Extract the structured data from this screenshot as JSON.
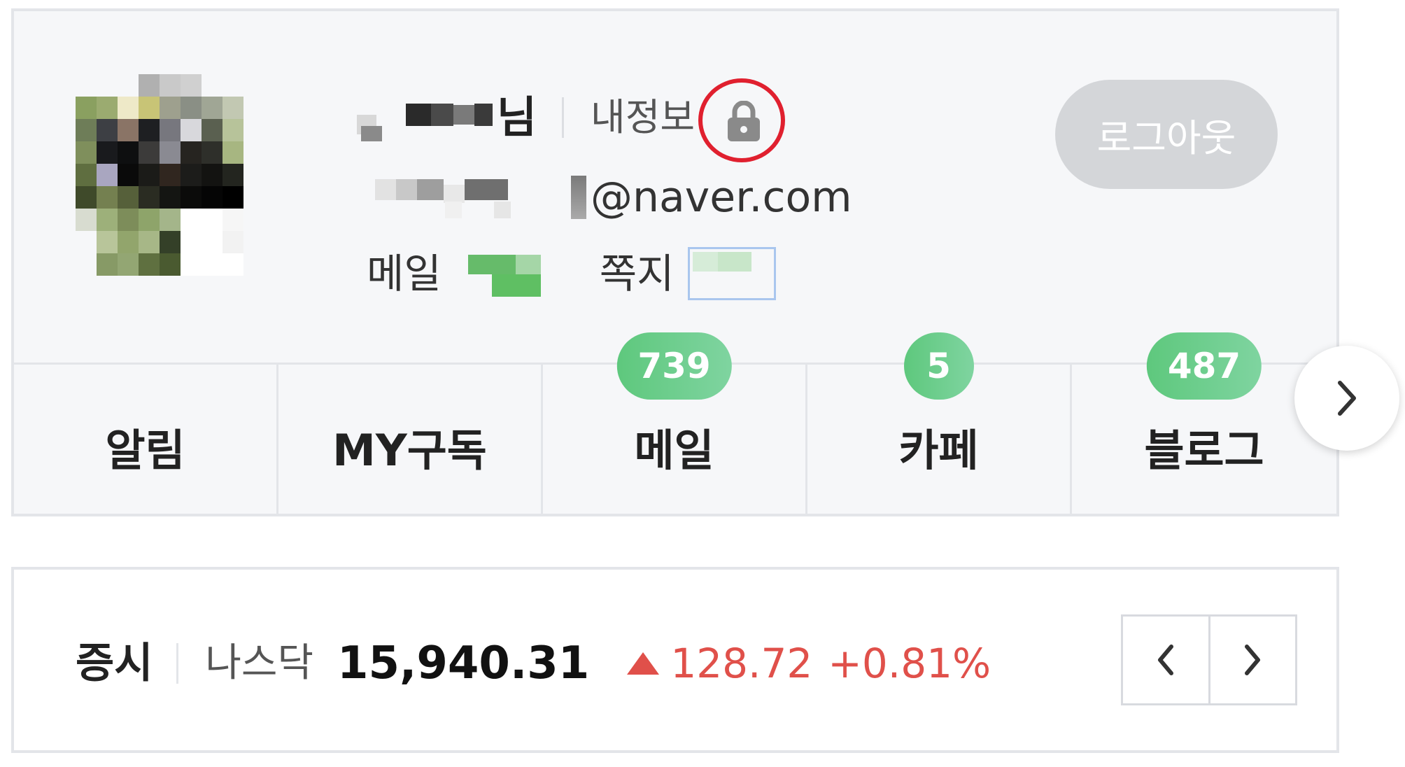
{
  "profile": {
    "username_suffix": "님",
    "myinfo_label": "내정보",
    "logout_label": "로그아웃",
    "email_domain": "@naver.com",
    "mail_label": "메일",
    "note_label": "쪽지"
  },
  "menu": {
    "items": [
      {
        "label": "알림",
        "badge": null
      },
      {
        "label": "MY구독",
        "badge": null
      },
      {
        "label": "메일",
        "badge": "739"
      },
      {
        "label": "카페",
        "badge": "5"
      },
      {
        "label": "블로그",
        "badge": "487"
      }
    ]
  },
  "stock": {
    "title": "증시",
    "index_name": "나스닥",
    "value": "15,940.31",
    "change": "128.72",
    "percent": "+0.81%",
    "direction": "up",
    "up_color": "#e0504a"
  },
  "icons": {
    "lock": "lock-icon",
    "menu_next": "chevron-right-icon",
    "stock_prev": "chevron-left-icon",
    "stock_next": "chevron-right-icon"
  },
  "colors": {
    "badge": "#6acb8a",
    "highlight_ring": "#e0202f",
    "logout_bg": "#d4d6d9"
  }
}
